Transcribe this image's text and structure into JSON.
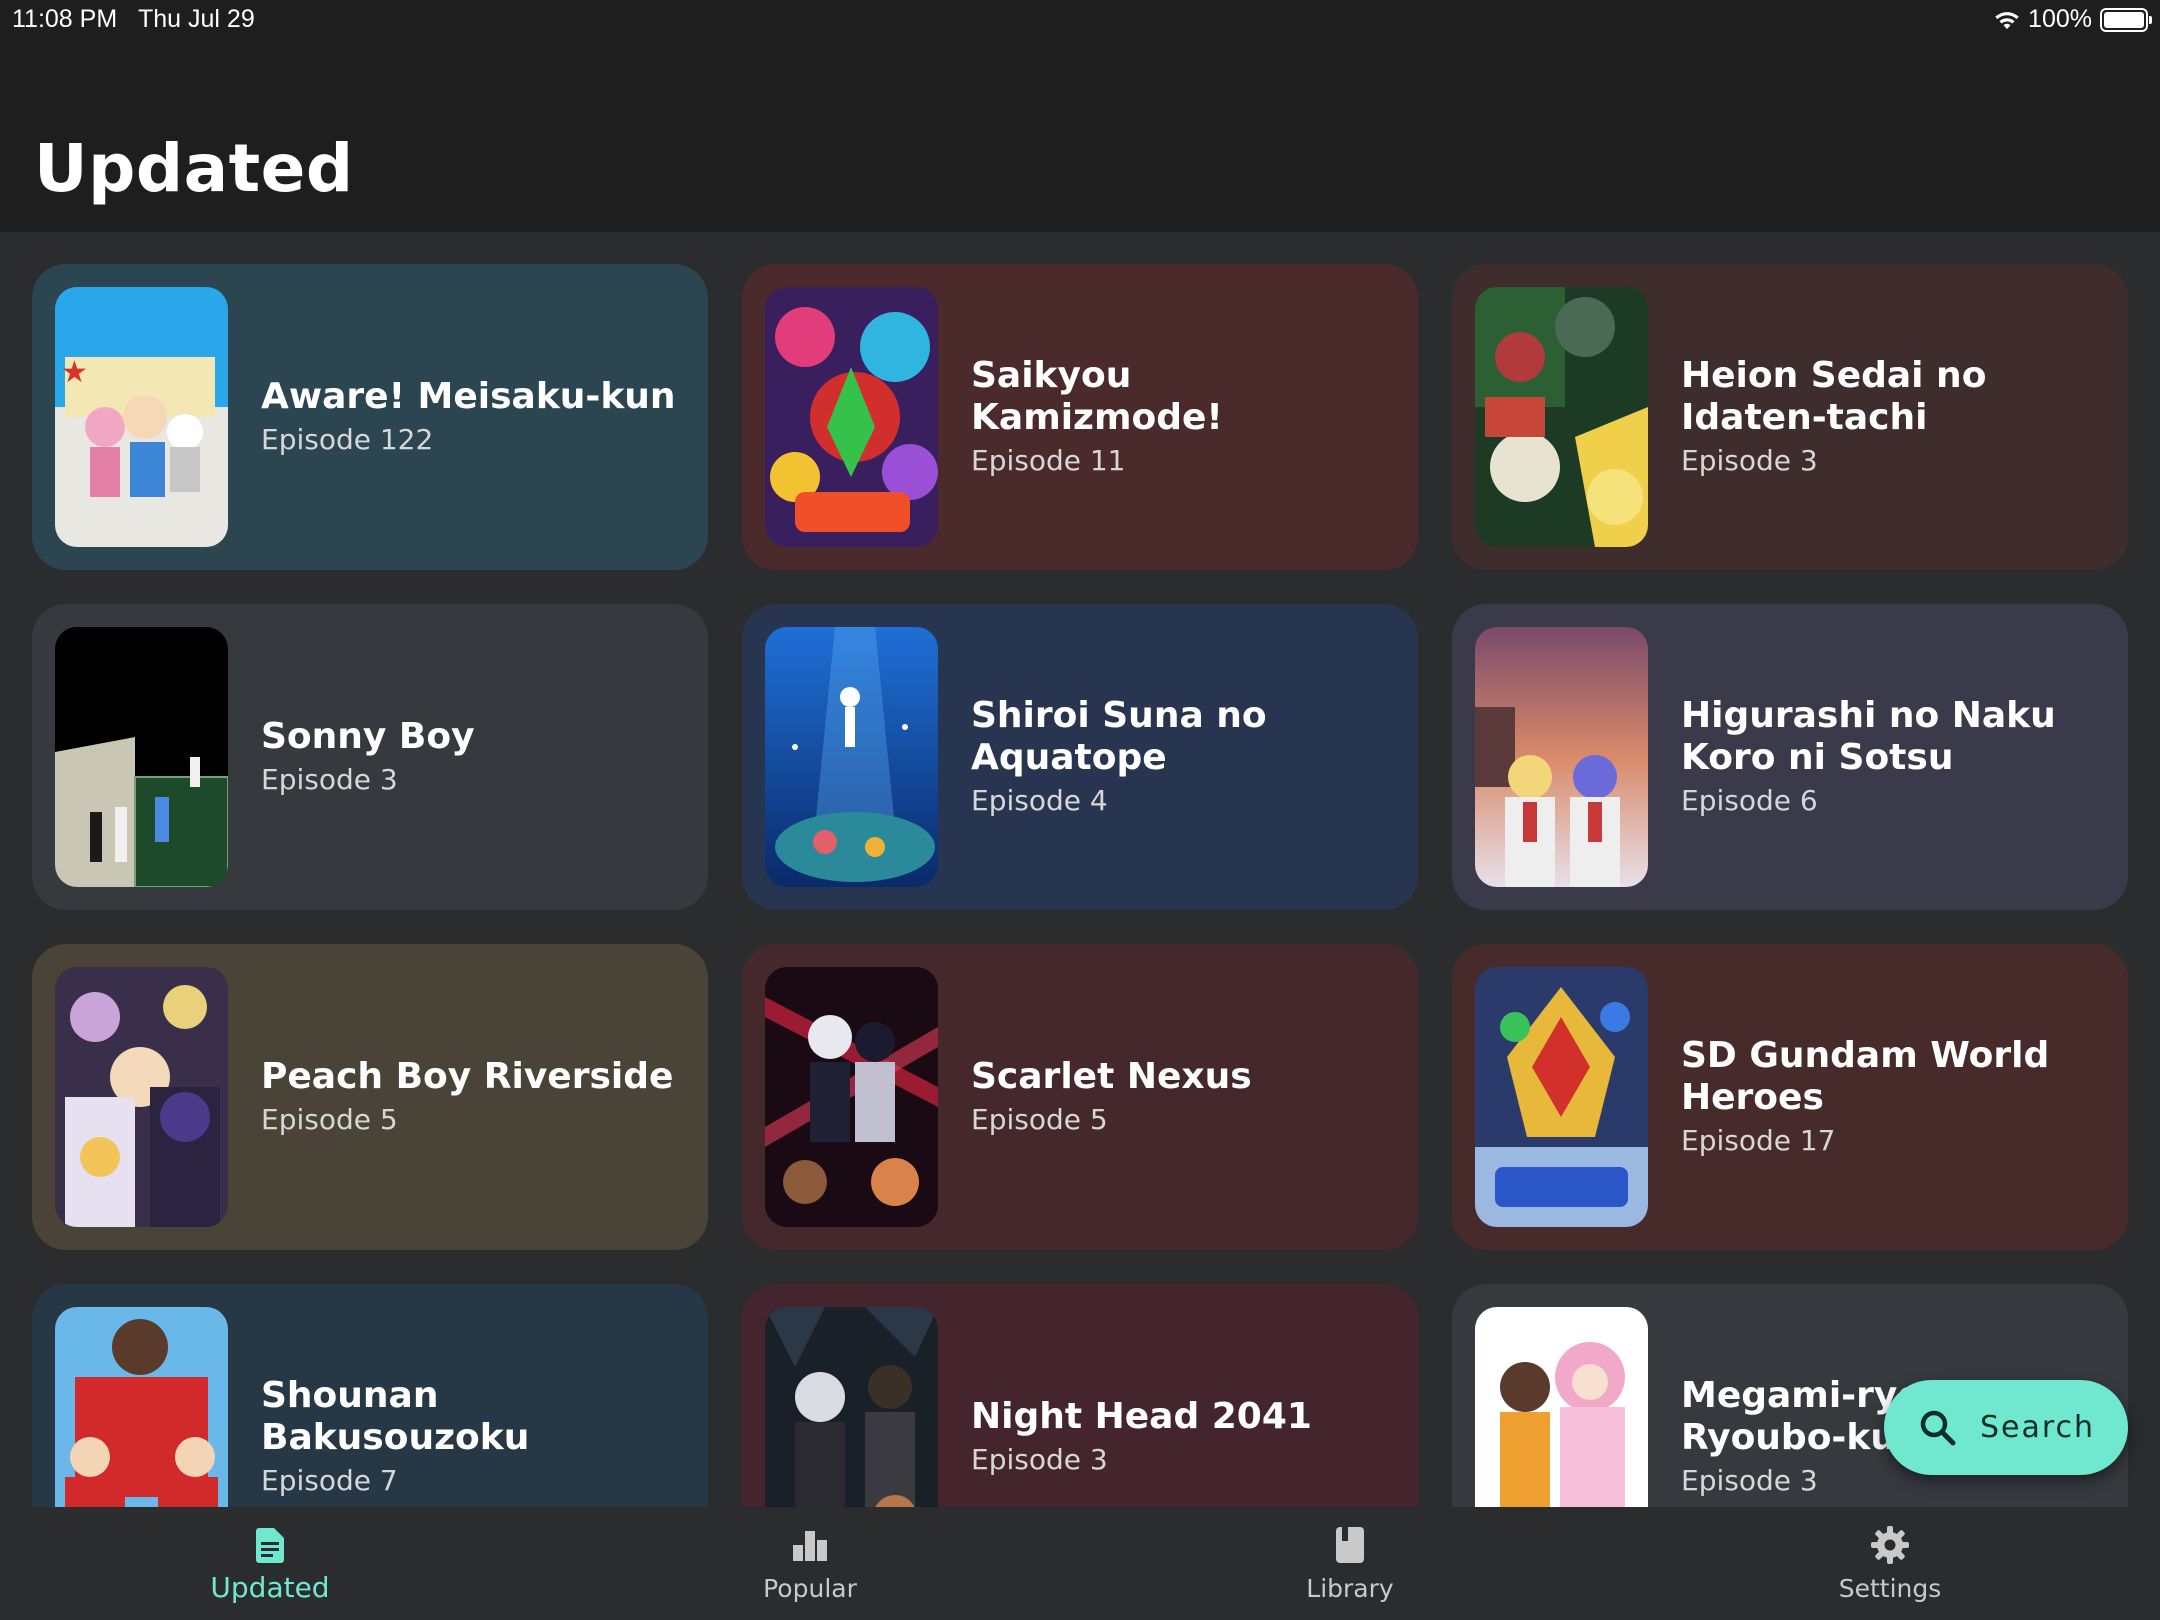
{
  "status_bar": {
    "time": "11:08 PM",
    "date": "Thu Jul 29",
    "battery": "100%",
    "icons": [
      "wifi-icon",
      "battery-icon"
    ]
  },
  "header": {
    "title": "Updated"
  },
  "colors": {
    "accent": "#6fe8cf",
    "header_bg": "#1e1e1f",
    "page_bg": "#2b2c2d"
  },
  "cards": [
    {
      "title": "Aware! Meisaku-kun",
      "episode": "Episode 122",
      "bg": "#2b4650"
    },
    {
      "title": "Saikyou Kamizmode!",
      "episode": "Episode 11",
      "bg": "#4a2a2b"
    },
    {
      "title": "Heion Sedai no Idaten-tachi",
      "episode": "Episode 3",
      "bg": "#3f2c2d"
    },
    {
      "title": "Sonny Boy",
      "episode": "Episode 3",
      "bg": "#363a3e"
    },
    {
      "title": "Shiroi Suna no Aquatope",
      "episode": "Episode 4",
      "bg": "#273550"
    },
    {
      "title": "Higurashi no Naku Koro ni Sotsu",
      "episode": "Episode 6",
      "bg": "#3a3a4b"
    },
    {
      "title": "Peach Boy Riverside",
      "episode": "Episode 5",
      "bg": "#4a4438"
    },
    {
      "title": "Scarlet Nexus",
      "episode": "Episode 5",
      "bg": "#45282b"
    },
    {
      "title": "SD Gundam World Heroes",
      "episode": "Episode 17",
      "bg": "#472b2b"
    },
    {
      "title": "Shounan Bakusouzoku",
      "episode": "Episode 7",
      "bg": "#263746"
    },
    {
      "title": "Night Head 2041",
      "episode": "Episode 3",
      "bg": "#45252d"
    },
    {
      "title": "Megami-ryou no Ryoubo-kun.",
      "episode": "Episode 3",
      "bg": "#363a3e"
    }
  ],
  "fab": {
    "label": "Search",
    "icon": "search-icon"
  },
  "bottom_nav": {
    "items": [
      {
        "label": "Updated",
        "icon": "document-icon",
        "active": true
      },
      {
        "label": "Popular",
        "icon": "bar-chart-icon",
        "active": false
      },
      {
        "label": "Library",
        "icon": "book-icon",
        "active": false
      },
      {
        "label": "Settings",
        "icon": "gear-icon",
        "active": false
      }
    ]
  }
}
